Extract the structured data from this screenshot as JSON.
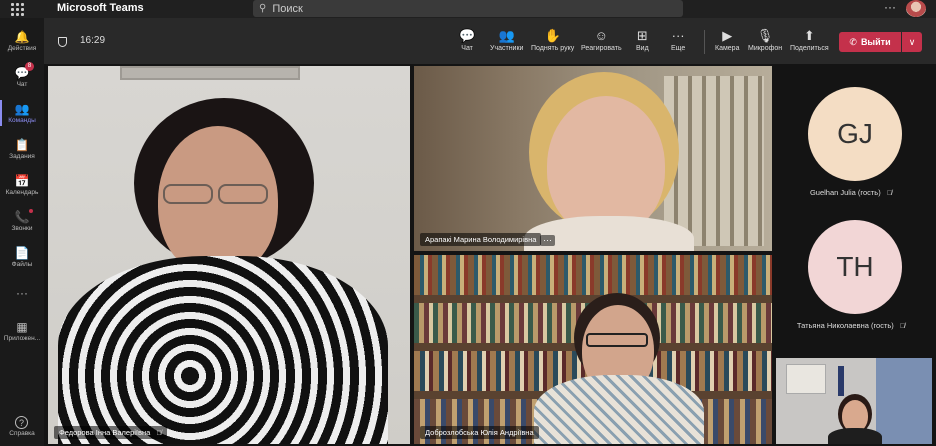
{
  "titlebar": {
    "app_title": "Microsoft Teams",
    "search_placeholder": "Поиск",
    "more": "···"
  },
  "rail": {
    "items": [
      {
        "label": "Действия",
        "icon": "bell-icon",
        "glyph": "🔔"
      },
      {
        "label": "Чат",
        "icon": "chat-icon",
        "glyph": "💬",
        "badge": "8"
      },
      {
        "label": "Команды",
        "icon": "teams-icon",
        "glyph": "👥",
        "active": true
      },
      {
        "label": "Задания",
        "icon": "assignments-icon",
        "glyph": "📋"
      },
      {
        "label": "Календарь",
        "icon": "calendar-icon",
        "glyph": "📅"
      },
      {
        "label": "Звонки",
        "icon": "phone-icon",
        "glyph": "📞"
      },
      {
        "label": "Файлы",
        "icon": "files-icon",
        "glyph": "📄"
      },
      {
        "label": "Приложен...",
        "icon": "apps-icon",
        "glyph": "▦"
      },
      {
        "label": "Справка",
        "icon": "help-icon",
        "glyph": "?"
      }
    ],
    "more": "···"
  },
  "toolbar": {
    "timer": "16:29",
    "buttons": [
      {
        "label": "Чат",
        "icon": "chat-icon",
        "glyph": "💬"
      },
      {
        "label": "Участники",
        "icon": "participants-icon",
        "glyph": "👥"
      },
      {
        "label": "Поднять руку",
        "icon": "raise-hand-icon",
        "glyph": "✋"
      },
      {
        "label": "Реагировать",
        "icon": "smile-icon",
        "glyph": "☺"
      },
      {
        "label": "Вид",
        "icon": "grid-view-icon",
        "glyph": "⊞"
      },
      {
        "label": "Еще",
        "icon": "more-icon",
        "glyph": "···"
      },
      {
        "label": "Камера",
        "icon": "camera-icon",
        "glyph": "▶"
      },
      {
        "label": "Микрофон",
        "icon": "microphone-icon",
        "glyph": "🎙"
      },
      {
        "label": "Поделиться",
        "icon": "share-icon",
        "glyph": "⬆"
      }
    ],
    "leave_label": "Выйти",
    "leave_glyph": "✆",
    "caret": "∨"
  },
  "participants": {
    "main": {
      "name": "Федорова Інна Валеріївна"
    },
    "top_right": {
      "name": "Арапакі Марина Володимирівна",
      "more": "···"
    },
    "bottom_right": {
      "name": "Доброзлобська Юлія Андріївна"
    },
    "side": [
      {
        "initials": "GJ",
        "name": "Guelhan Julia (гость)",
        "color": "#f4ddc4"
      },
      {
        "initials": "TH",
        "name": "Татьяна Николаевна (гость)",
        "color": "#f2d6d6"
      }
    ],
    "mic_off_glyph": "🎙̸"
  }
}
